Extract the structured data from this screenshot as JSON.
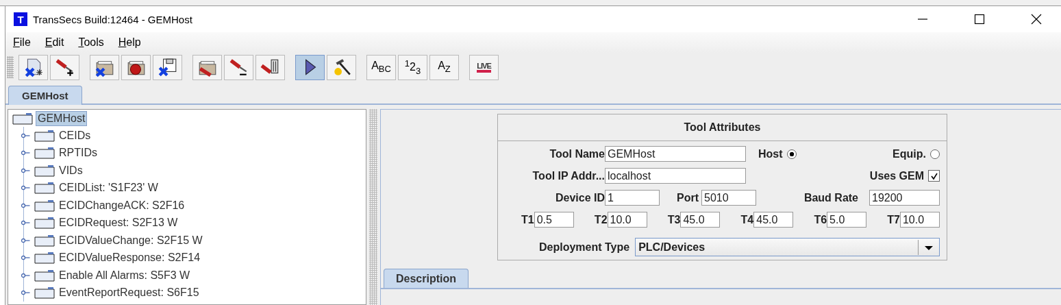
{
  "window": {
    "title": "TransSecs Build:12464 - GEMHost",
    "app_icon": "T"
  },
  "menu": [
    {
      "label": "File"
    },
    {
      "label": "Edit"
    },
    {
      "label": "Tools"
    },
    {
      "label": "Help"
    }
  ],
  "toolbar": [
    [
      {
        "kind": "new-doc",
        "selected": false
      },
      {
        "kind": "tool-add",
        "selected": false
      }
    ],
    [
      {
        "kind": "folder-x",
        "selected": false
      },
      {
        "kind": "folder-stop",
        "selected": false
      },
      {
        "kind": "disk-x",
        "selected": false
      }
    ],
    [
      {
        "kind": "folder-tool",
        "selected": false
      },
      {
        "kind": "tool-remove",
        "selected": false
      },
      {
        "kind": "tool-trash",
        "selected": false
      }
    ],
    [
      {
        "kind": "play",
        "selected": true
      },
      {
        "kind": "hammer",
        "selected": false
      }
    ],
    [
      {
        "kind": "text",
        "label": "A$_{B}$$_{C}$",
        "selected": false
      },
      {
        "kind": "text",
        "label": "$^{1}$2$_{3}$",
        "selected": false
      },
      {
        "kind": "text",
        "label": "A$_{Z}$",
        "selected": false
      }
    ],
    [
      {
        "kind": "live",
        "label": "LIVE",
        "selected": false
      }
    ]
  ],
  "tabs": [
    {
      "label": "GEMHost",
      "selected": true
    }
  ],
  "tree": {
    "label": "GEMHost",
    "selected": true,
    "children": [
      {
        "label": "CEIDs"
      },
      {
        "label": "RPTIDs"
      },
      {
        "label": "VIDs"
      },
      {
        "label": "CEIDList: 'S1F23' W"
      },
      {
        "label": "ECIDChangeACK: S2F16"
      },
      {
        "label": "ECIDRequest: S2F13 W"
      },
      {
        "label": "ECIDValueChange: S2F15 W"
      },
      {
        "label": "ECIDValueResponse: S2F14"
      },
      {
        "label": "Enable All Alarms: S5F3 W"
      },
      {
        "label": "EventReportRequest: S6F15"
      }
    ]
  },
  "tool_attributes": {
    "title": "Tool Attributes",
    "tool_name": {
      "label": "Tool Name",
      "value": "GEMHost"
    },
    "host": {
      "label": "Host",
      "selected": true
    },
    "equip": {
      "label": "Equip.",
      "selected": false
    },
    "tool_ip": {
      "label": "Tool IP Addr...",
      "value": "localhost"
    },
    "uses_gem": {
      "label": "Uses GEM",
      "checked": true
    },
    "device_id": {
      "label": "Device ID",
      "value": "1"
    },
    "port": {
      "label": "Port",
      "value": "5010"
    },
    "baud_rate": {
      "label": "Baud Rate",
      "value": "19200"
    },
    "timers": [
      {
        "label": "T1",
        "value": "0.5"
      },
      {
        "label": "T2",
        "value": "10.0"
      },
      {
        "label": "T3",
        "value": "45.0"
      },
      {
        "label": "T4",
        "value": "45.0"
      },
      {
        "label": "T6",
        "value": "5.0"
      },
      {
        "label": "T7",
        "value": "10.0"
      }
    ],
    "deployment_type": {
      "label": "Deployment Type",
      "value": "PLC/Devices"
    }
  },
  "bottom_tabs": [
    {
      "label": "Description",
      "selected": true
    }
  ]
}
